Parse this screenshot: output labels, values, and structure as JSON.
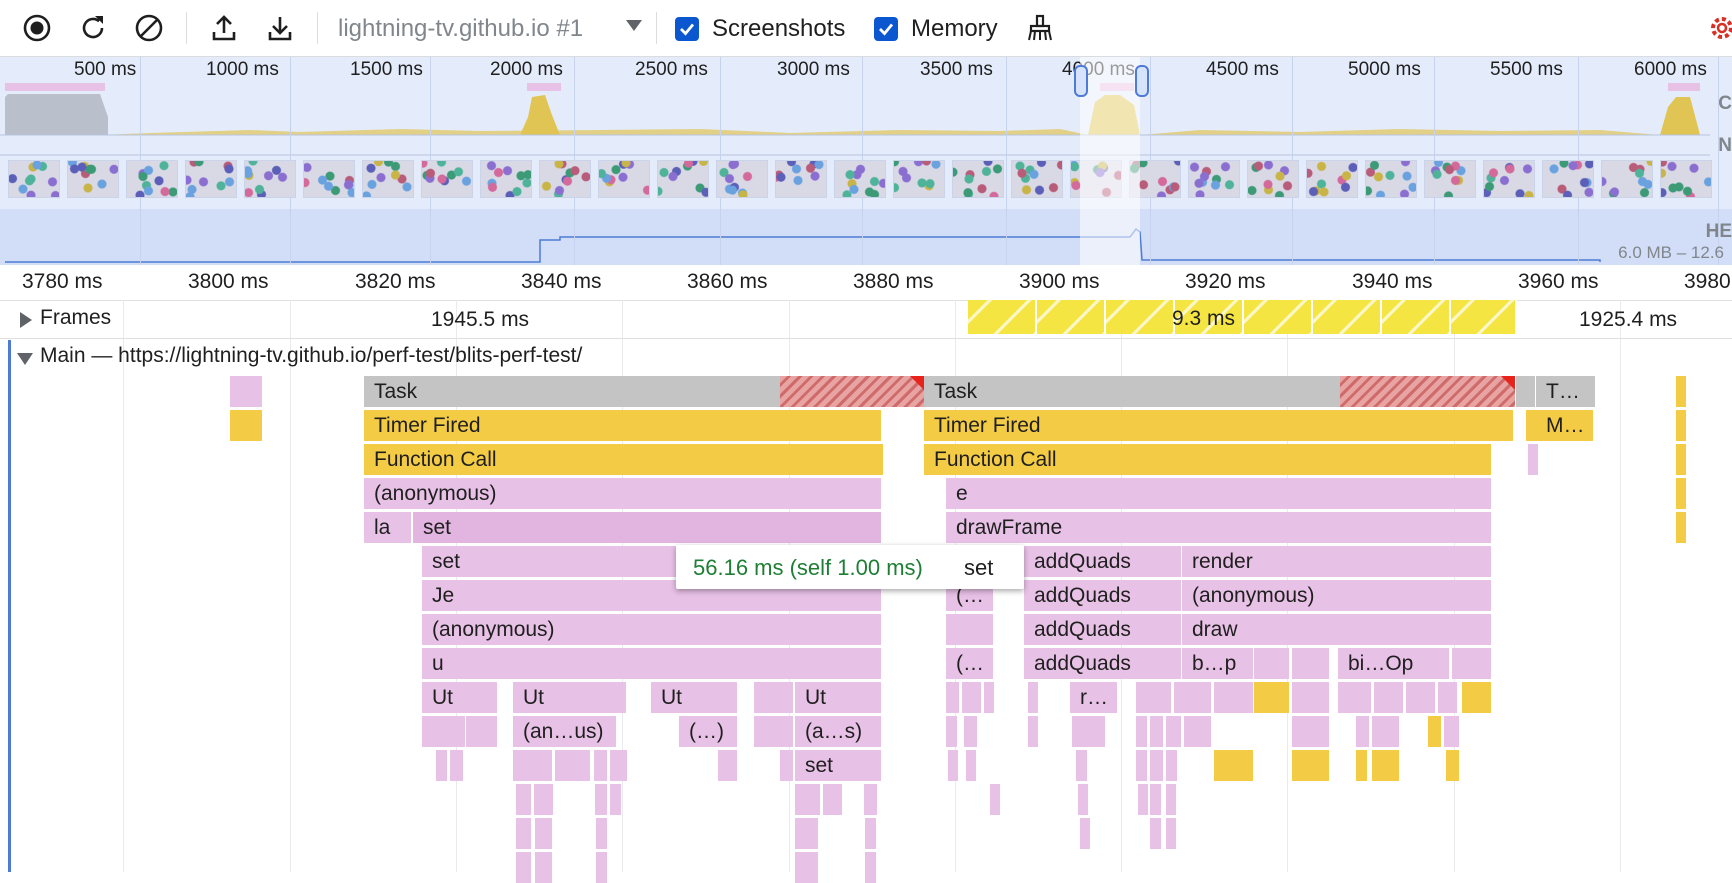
{
  "toolbar": {
    "profile_name": "lightning-tv.github.io #1",
    "screenshots_label": "Screenshots",
    "memory_label": "Memory",
    "screenshots_checked": true,
    "memory_checked": true,
    "accent_color": "#0b57d0"
  },
  "overview": {
    "ticks": [
      "500 ms",
      "1000 ms",
      "1500 ms",
      "2000 ms",
      "2500 ms",
      "3000 ms",
      "3500 ms",
      "4000 ms",
      "4500 ms",
      "5000 ms",
      "5500 ms",
      "6000 ms"
    ],
    "side_labels": [
      "C",
      "N",
      "HE"
    ],
    "heap_range": "6.0 MB – 12.6"
  },
  "ruler": {
    "ticks": [
      "3780 ms",
      "3800 ms",
      "3820 ms",
      "3840 ms",
      "3860 ms",
      "3880 ms",
      "3900 ms",
      "3920 ms",
      "3940 ms",
      "3960 ms",
      "3980"
    ]
  },
  "frames": {
    "title": "Frames",
    "values": [
      "1945.5 ms",
      "9.3 ms",
      "1925.4 ms"
    ]
  },
  "main": {
    "title": "Main — https://lightning-tv.github.io/perf-test/blits-perf-test/"
  },
  "flame": {
    "labels": {
      "task": "Task",
      "timer": "Timer Fired",
      "function_call": "Function Call",
      "anonymous": "(anonymous)",
      "la": "la",
      "set": "set",
      "je": "Je",
      "u": "u",
      "ut": "Ut",
      "anus": "(an…us)",
      "dots": "(…)",
      "as": "(a…s)",
      "e": "e",
      "drawframe": "drawFrame",
      "addquads": "addQuads",
      "render": "render",
      "draw": "draw",
      "bp": "b…p",
      "biop": "bi…Op",
      "r": "r…",
      "paren": "(…",
      "t": "T…",
      "m": "M…"
    }
  },
  "tooltip": {
    "time": "56.16 ms (self 1.00 ms)",
    "name": "set"
  }
}
